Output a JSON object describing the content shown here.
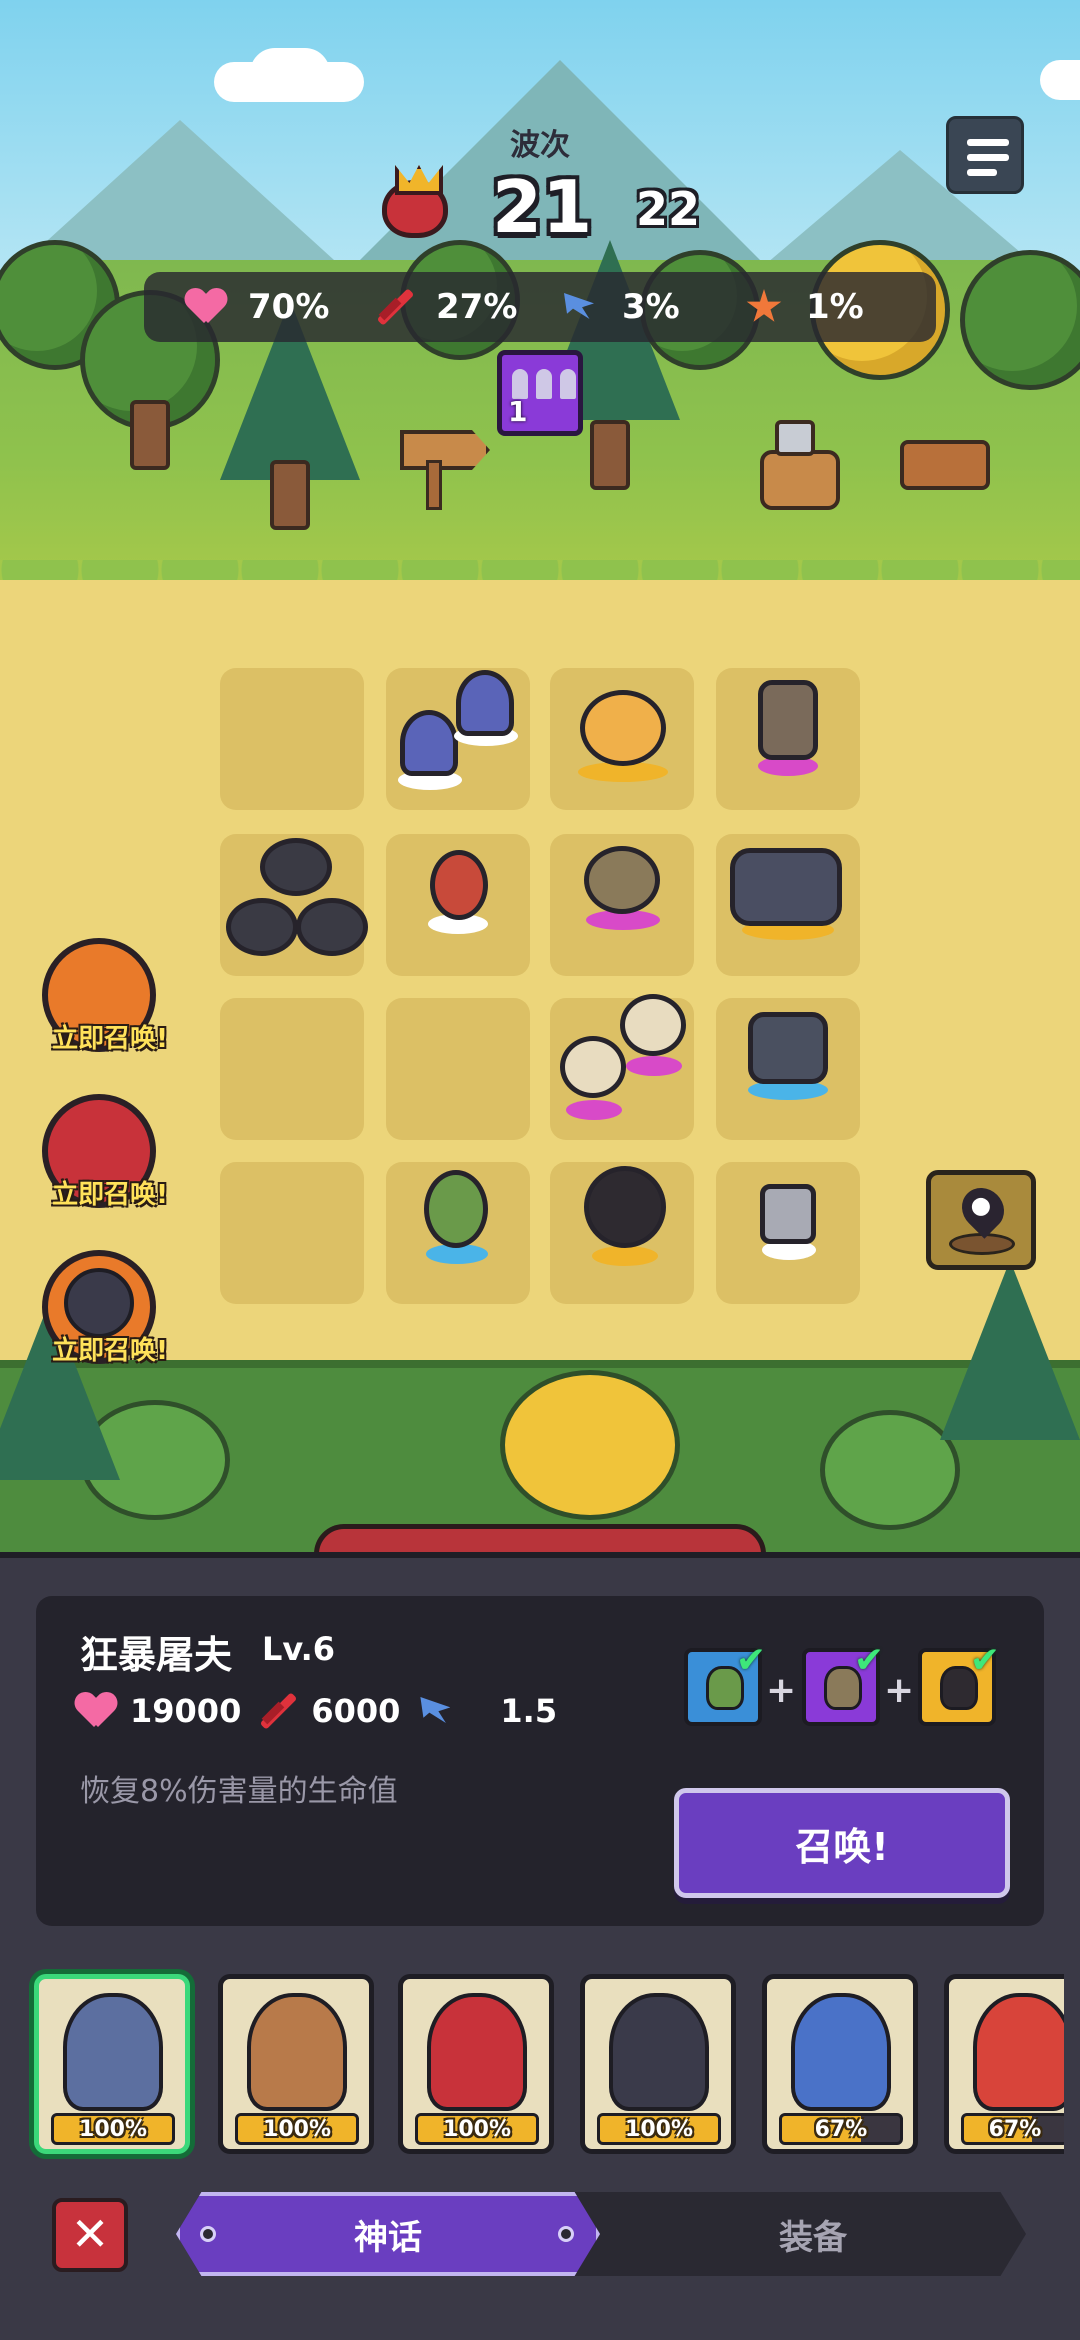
{
  "hud": {
    "wave_label": "波次",
    "wave_current": "21",
    "wave_total": "22",
    "stats": [
      {
        "icon": "heart-icon",
        "value": "70%"
      },
      {
        "icon": "sword-icon",
        "value": "27%"
      },
      {
        "icon": "attack-speed-icon",
        "value": "3%"
      },
      {
        "icon": "crit-icon",
        "value": "1%"
      }
    ],
    "army_count": "1"
  },
  "summon_prompts": [
    {
      "label": "立即召唤!",
      "color": "#e97a2a"
    },
    {
      "label": "立即召唤!",
      "color": "#c8323a"
    },
    {
      "label": "立即召唤!",
      "color": "#e97a2a"
    }
  ],
  "selected_unit": {
    "name": "狂暴屠夫",
    "level": "Lv.6",
    "hp": "19000",
    "attack": "6000",
    "attack_speed": "1.5",
    "description": "恢复8%伤害量的生命值",
    "summon_label": "召唤!"
  },
  "recipe": [
    {
      "icon": "archer-icon",
      "color": "#3a8fd8"
    },
    {
      "icon": "gunner-icon",
      "color": "#8a3ad8"
    },
    {
      "icon": "bandit-icon",
      "color": "#f0b42a"
    }
  ],
  "cards": [
    {
      "icon": "butcher-icon",
      "progress_label": "100%",
      "progress": 1.0,
      "color": "#5c6fa0"
    },
    {
      "icon": "cowboy-robot-icon",
      "progress_label": "100%",
      "progress": 1.0,
      "color": "#b87a4a"
    },
    {
      "icon": "red-demon-icon",
      "progress_label": "100%",
      "progress": 1.0,
      "color": "#c8323a"
    },
    {
      "icon": "ninja-icon",
      "progress_label": "100%",
      "progress": 1.0,
      "color": "#3a3a4a"
    },
    {
      "icon": "goggle-creature-icon",
      "progress_label": "67%",
      "progress": 0.67,
      "color": "#4a72c8"
    },
    {
      "icon": "red-hair-warrior-icon",
      "progress_label": "67%",
      "progress": 0.67,
      "color": "#d8443a"
    }
  ],
  "tabs": {
    "active": "神话",
    "inactive": "装备"
  },
  "colors": {
    "accent_purple": "#6a3ec0",
    "close_red": "#c8323c",
    "progress_gold": "#f0b42a"
  }
}
